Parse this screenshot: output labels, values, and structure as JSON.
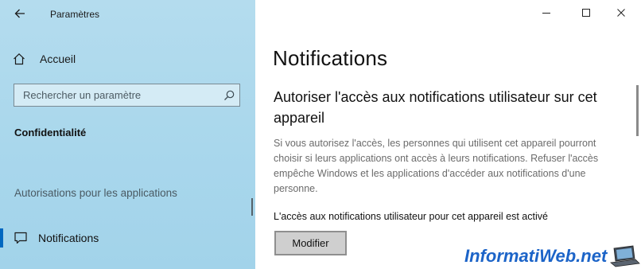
{
  "window": {
    "app_title": "Paramètres",
    "back_icon": "back-arrow-icon",
    "controls": [
      "minimize-icon",
      "maximize-icon",
      "close-icon"
    ]
  },
  "sidebar": {
    "home_label": "Accueil",
    "search_placeholder": "Rechercher un paramètre",
    "section_title": "Confidentialité",
    "group_label": "Autorisations pour les applications",
    "active_item": {
      "label": "Notifications",
      "icon": "notification-speech-bubble-icon"
    }
  },
  "main": {
    "page_title": "Notifications",
    "heading": "Autoriser l'accès aux notifications utilisateur sur cet appareil",
    "description": "Si vous autorisez l'accès, les personnes qui utilisent cet appareil pourront choisir si leurs applications ont accès à leurs notifications. Refuser l'accès empêche Windows et les applications d'accéder aux notifications d'une personne.",
    "status": "L'accès aux notifications utilisateur pour cet appareil est activé",
    "modify_button": "Modifier"
  },
  "watermark": {
    "text": "InformatiWeb.net"
  },
  "colors": {
    "sidebar_bg": "#aad8ed",
    "accent": "#0067c0",
    "watermark_blue": "#1c64c8",
    "button_bg": "#cfcfcf"
  }
}
